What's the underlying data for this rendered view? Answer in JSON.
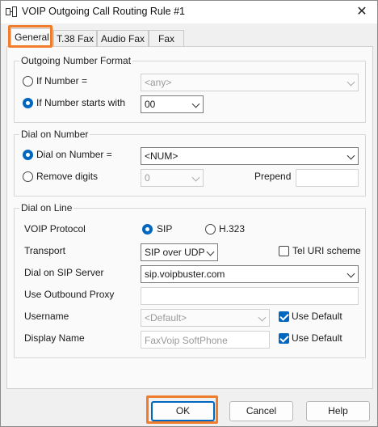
{
  "window": {
    "title": "VOIP Outgoing Call Routing Rule #1",
    "close_symbol": "✕"
  },
  "tabs": [
    {
      "label": "General",
      "active": true
    },
    {
      "label": "T.38 Fax",
      "active": false
    },
    {
      "label": "Audio Fax",
      "active": false
    },
    {
      "label": "Fax",
      "active": false
    }
  ],
  "outgoing_number_format": {
    "group_label": "Outgoing Number Format",
    "if_number": {
      "label": "If Number =",
      "selected": false,
      "value": "<any>"
    },
    "if_number_starts_with": {
      "label": "If Number starts with",
      "selected": true,
      "value": "00"
    }
  },
  "dial_on_number": {
    "group_label": "Dial on Number",
    "dial_on_number": {
      "label": "Dial on Number =",
      "selected": true,
      "value": "<NUM>"
    },
    "remove_digits": {
      "label": "Remove digits",
      "selected": false,
      "value": "0"
    },
    "prepend": {
      "label": "Prepend",
      "value": ""
    }
  },
  "dial_on_line": {
    "group_label": "Dial on Line",
    "voip_protocol": {
      "label": "VOIP Protocol",
      "options": [
        {
          "label": "SIP",
          "selected": true
        },
        {
          "label": "H.323",
          "selected": false
        }
      ]
    },
    "transport": {
      "label": "Transport",
      "value": "SIP over UDP"
    },
    "tel_uri_scheme": {
      "label": "Tel URI scheme",
      "checked": false
    },
    "sip_server": {
      "label": "Dial on SIP Server",
      "value": "sip.voipbuster.com"
    },
    "outbound_proxy": {
      "label": "Use Outbound Proxy",
      "value": ""
    },
    "username": {
      "label": "Username",
      "value": "<Default>",
      "use_default_label": "Use Default",
      "use_default": true
    },
    "display_name": {
      "label": "Display Name",
      "value": "FaxVoip SoftPhone",
      "use_default_label": "Use Default",
      "use_default": true
    }
  },
  "buttons": {
    "ok": "OK",
    "cancel": "Cancel",
    "help": "Help"
  },
  "colors": {
    "accent": "#0067c0",
    "highlight": "#ef7d2b"
  }
}
